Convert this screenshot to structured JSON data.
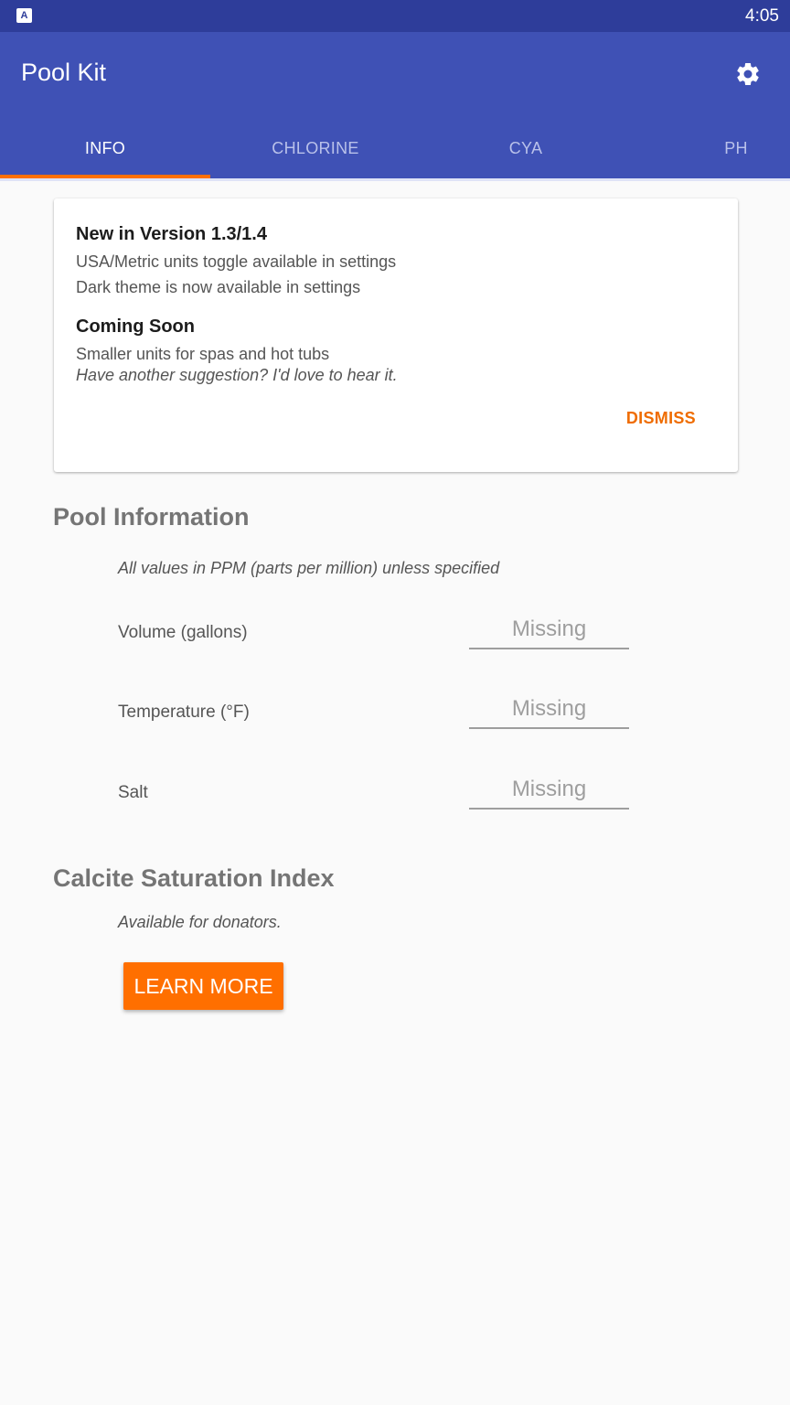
{
  "status_bar": {
    "time": "4:05",
    "app_icon_letter": "A"
  },
  "app_bar": {
    "title": "Pool Kit",
    "settings_icon": "gear-icon"
  },
  "tabs": [
    {
      "label": "INFO",
      "active": true
    },
    {
      "label": "CHLORINE",
      "active": false
    },
    {
      "label": "CYA",
      "active": false
    },
    {
      "label": "PH",
      "active": false
    }
  ],
  "announcement": {
    "new_heading": "New in Version 1.3/1.4",
    "new_items": [
      "USA/Metric units toggle available in settings",
      "Dark theme is now available in settings"
    ],
    "soon_heading": "Coming Soon",
    "soon_item": "Smaller units for spas and hot tubs",
    "suggestion": "Have another suggestion? I'd love to hear it.",
    "dismiss_label": "DISMISS"
  },
  "pool_info": {
    "title": "Pool Information",
    "note": "All values in PPM (parts per million) unless specified",
    "fields": [
      {
        "label": "Volume (gallons)",
        "placeholder": "Missing"
      },
      {
        "label": "Temperature (°F)",
        "placeholder": "Missing"
      },
      {
        "label": "Salt",
        "placeholder": "Missing"
      }
    ]
  },
  "csi": {
    "title": "Calcite Saturation Index",
    "note": "Available for donators.",
    "button_label": "LEARN MORE"
  },
  "colors": {
    "primary": "#3f51b5",
    "primary_dark": "#2e3d9a",
    "accent": "#ff6f00"
  }
}
